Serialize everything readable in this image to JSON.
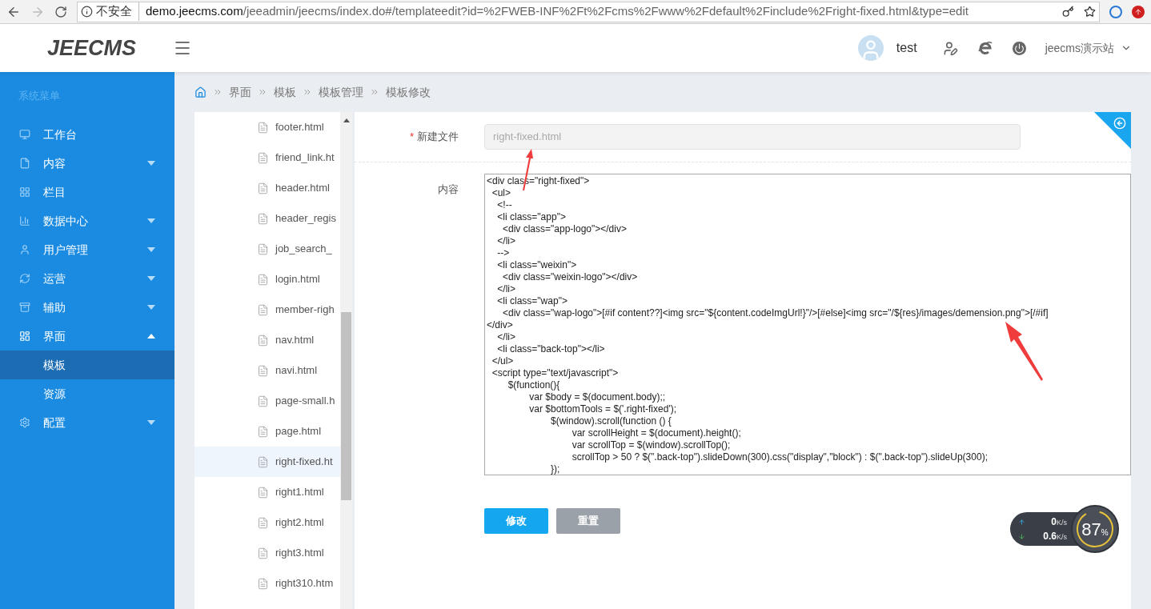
{
  "browser": {
    "security": "不安全",
    "url_host": "demo.jeecms.com",
    "url_path": "/jeeadmin/jeecms/index.do#/templateedit?id=%2FWEB-INF%2Ft%2Fcms%2Fwww%2Fdefault%2Finclude%2Fright-fixed.html&type=edit"
  },
  "header": {
    "logo": "JEECMS",
    "user": "test",
    "site": "jeecms演示站"
  },
  "sidebar": {
    "title": "系统菜单",
    "items": [
      {
        "label": "工作台",
        "kind": "link"
      },
      {
        "label": "内容",
        "kind": "group",
        "expanded": false
      },
      {
        "label": "栏目",
        "kind": "link"
      },
      {
        "label": "数据中心",
        "kind": "group",
        "expanded": false
      },
      {
        "label": "用户管理",
        "kind": "group",
        "expanded": false
      },
      {
        "label": "运营",
        "kind": "group",
        "expanded": false
      },
      {
        "label": "辅助",
        "kind": "group",
        "expanded": false
      },
      {
        "label": "界面",
        "kind": "group",
        "expanded": true,
        "children": [
          {
            "label": "模板",
            "selected": true
          },
          {
            "label": "资源",
            "selected": false
          }
        ]
      },
      {
        "label": "配置",
        "kind": "group",
        "expanded": false
      }
    ]
  },
  "breadcrumb": [
    "界面",
    "模板",
    "模板管理",
    "模板修改"
  ],
  "files": [
    {
      "name": "footer.html",
      "selected": false
    },
    {
      "name": "friend_link.ht",
      "selected": false
    },
    {
      "name": "header.html",
      "selected": false
    },
    {
      "name": "header_regis",
      "selected": false
    },
    {
      "name": "job_search_",
      "selected": false
    },
    {
      "name": "login.html",
      "selected": false
    },
    {
      "name": "member-righ",
      "selected": false
    },
    {
      "name": "nav.html",
      "selected": false
    },
    {
      "name": "navi.html",
      "selected": false
    },
    {
      "name": "page-small.h",
      "selected": false
    },
    {
      "name": "page.html",
      "selected": false
    },
    {
      "name": "right-fixed.ht",
      "selected": true
    },
    {
      "name": "right1.html",
      "selected": false
    },
    {
      "name": "right2.html",
      "selected": false
    },
    {
      "name": "right3.html",
      "selected": false
    },
    {
      "name": "right310.htm",
      "selected": false
    }
  ],
  "form": {
    "filename_label": "新建文件",
    "required_mark": "*",
    "filename": "right-fixed.html",
    "content_label": "内容",
    "code": "<div class=\"right-fixed\">\n  <ul>\n    <!--\n    <li class=\"app\">\n      <div class=\"app-logo\"></div>\n    </li>\n    -->\n    <li class=\"weixin\">\n      <div class=\"weixin-logo\"></div>\n    </li>\n    <li class=\"wap\">\n      <div class=\"wap-logo\">[#if content??]<img src=\"${content.codeImgUrl!}\"/>[#else]<img src=\"/${res}/images/demension.png\">[/#if]\n</div>\n    </li>\n    <li class=\"back-top\"></li>\n  </ul>\n  <script type=\"text/javascript\">\n        $(function(){\n                var $body = $(document.body);;\n                var $bottomTools = $('.right-fixed');\n                        $(window).scroll(function () {\n                                var scrollHeight = $(document).height();\n                                var scrollTop = $(window).scrollTop();\n                                scrollTop > 50 ? $(\".back-top\").slideDown(300).css(\"display\",\"block\") : $(\".back-top\").slideUp(300);\n                        });",
    "buttons": [
      {
        "label": "修改",
        "kind": "primary"
      },
      {
        "label": "重置",
        "kind": "secondary"
      }
    ]
  },
  "netspeed": {
    "up": "0",
    "up_unit": "K/s",
    "down": "0.6",
    "down_unit": "K/s",
    "percent": "87",
    "percent_sign": "%"
  }
}
